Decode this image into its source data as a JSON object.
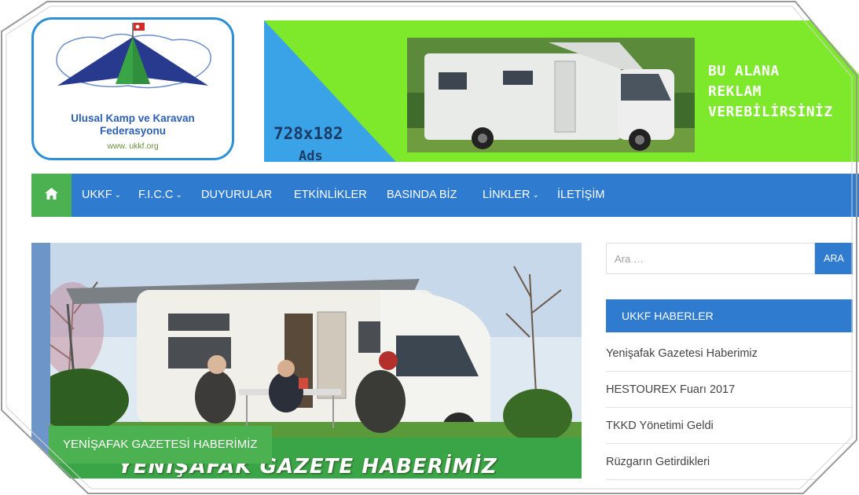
{
  "logo": {
    "name_line1": "Ulusal Kamp ve Karavan",
    "name_line2": "Federasyonu",
    "url": "www. ukkf.org"
  },
  "banner": {
    "size_text": "728x182",
    "ads_text": "Ads",
    "promo_line1": "BU ALANA",
    "promo_line2": "REKLAM",
    "promo_line3": "VEREBİLİRSİNİZ"
  },
  "nav": {
    "home_icon": "home-icon",
    "items": [
      {
        "label": "UKKF",
        "dropdown": true
      },
      {
        "label": "F.I.C.C",
        "dropdown": true
      },
      {
        "label": "DUYURULAR",
        "dropdown": false
      },
      {
        "label": "ETKİNLİKLER",
        "dropdown": false
      },
      {
        "label": "BASINDA BİZ",
        "dropdown": false
      },
      {
        "label": "LİNKLER",
        "dropdown": true
      },
      {
        "label": "İLETİŞİM",
        "dropdown": false
      }
    ]
  },
  "feature": {
    "caption": "YENİŞAFAK GAZETESİ HABERİMİZ",
    "image_overlay_text": "YENİŞAFAK GAZETE HABERİMİZ"
  },
  "sidebar": {
    "search_placeholder": "Ara …",
    "search_button": "ARA",
    "widget_title": "UKKF HABERLER",
    "news": [
      "Yenişafak Gazetesi Haberimiz",
      "HESTOUREX Fuarı 2017",
      "TKKD Yönetimi Geldi",
      "Rüzgarın Getirdikleri"
    ]
  },
  "colors": {
    "nav_blue": "#2e7bcf",
    "accent_green": "#4cb150",
    "banner_green": "#7ee82a",
    "banner_blue": "#3aa2e6"
  }
}
